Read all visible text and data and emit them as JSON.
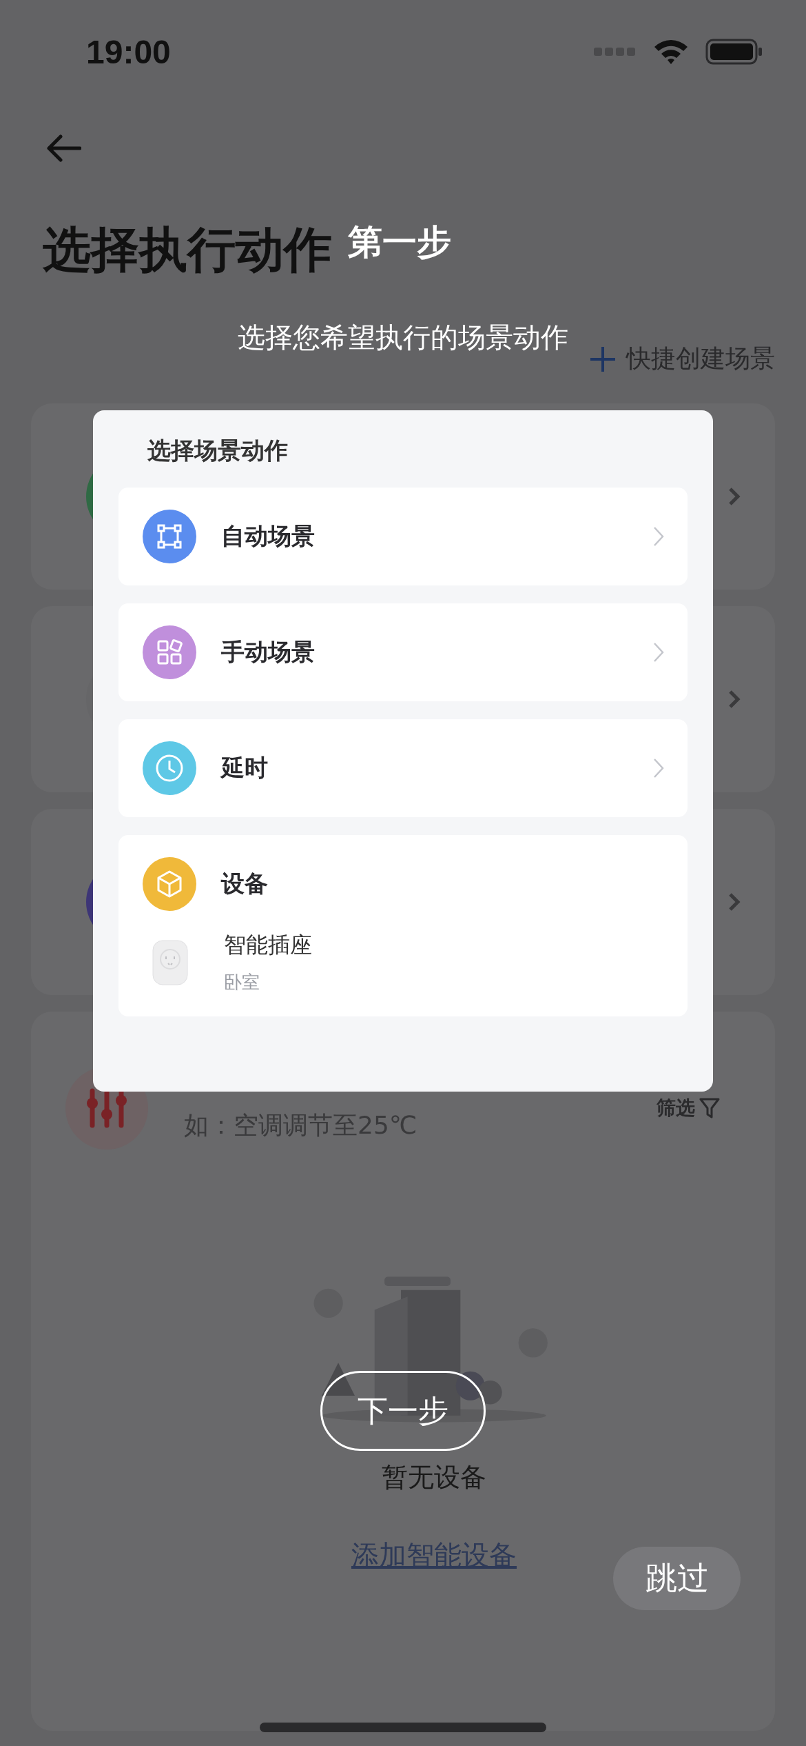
{
  "status_bar": {
    "time": "19:00"
  },
  "header": {
    "title": "选择执行动作",
    "quick_create": "快捷创建场景"
  },
  "background_cards": [
    {
      "color": "#2f6a44"
    },
    {
      "color": "#666668"
    },
    {
      "color": "#3d3577"
    }
  ],
  "device_panel": {
    "subtitle": "如：空调调节至25℃",
    "filter": "筛选",
    "empty_text": "暂无设备",
    "add_link": "添加智能设备"
  },
  "guide": {
    "step": "第一步",
    "hint": "选择您希望执行的场景动作",
    "next": "下一步",
    "skip": "跳过"
  },
  "modal": {
    "title": "选择场景动作",
    "options": [
      {
        "kind": "auto",
        "label": "自动场景",
        "color": "#5b8def"
      },
      {
        "kind": "manual",
        "label": "手动场景",
        "color": "#c08fdc"
      },
      {
        "kind": "delay",
        "label": "延时",
        "color": "#5ec8e6"
      }
    ],
    "device_group": {
      "label": "设备",
      "color": "#f0b93a",
      "devices": [
        {
          "name": "智能插座",
          "room": "卧室"
        }
      ]
    }
  }
}
